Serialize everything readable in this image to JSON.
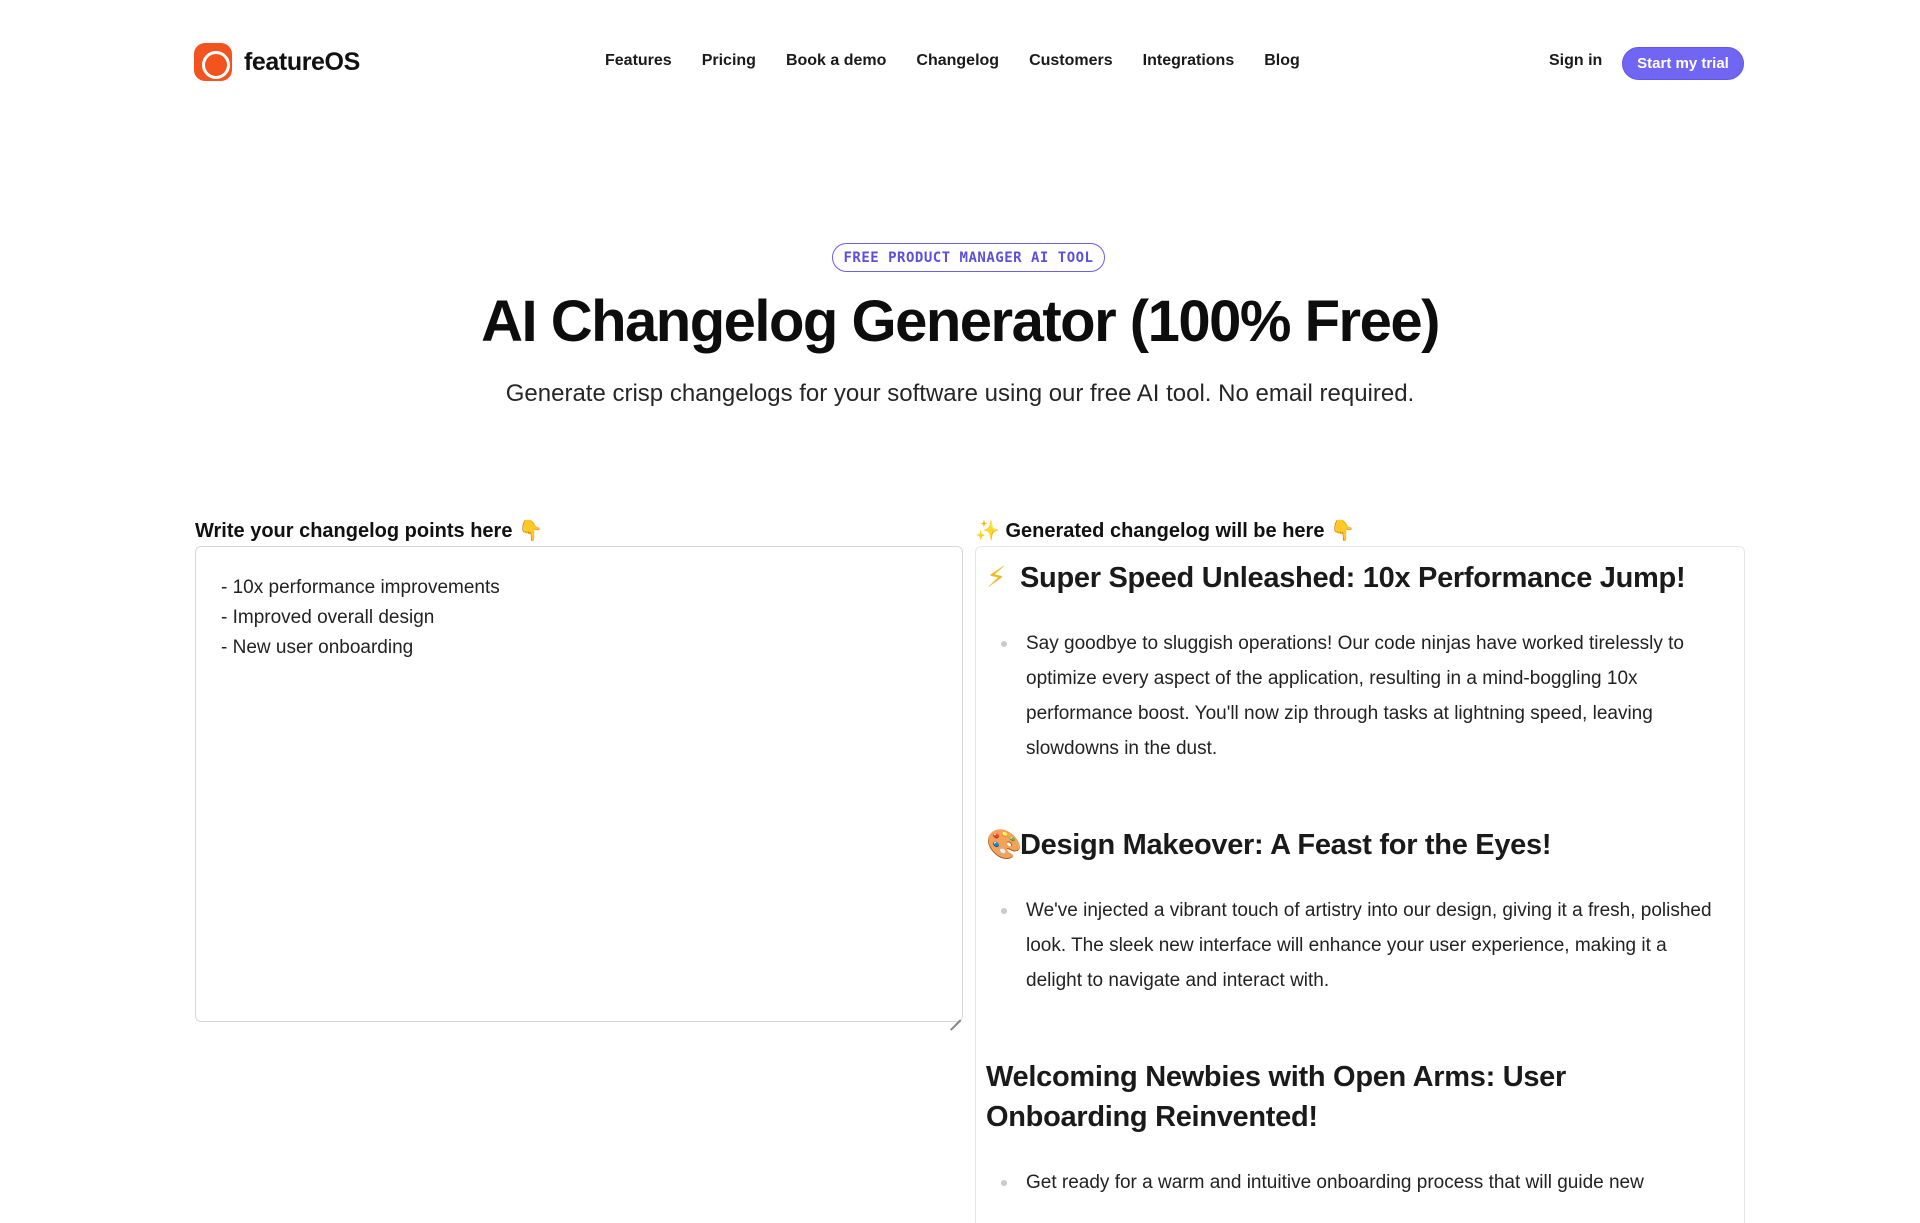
{
  "nav": {
    "brand": "featureOS",
    "links": [
      "Features",
      "Pricing",
      "Book a demo",
      "Changelog",
      "Customers",
      "Integrations",
      "Blog"
    ],
    "sign_in": "Sign in",
    "cta": "Start my trial"
  },
  "hero": {
    "badge": "FREE PRODUCT MANAGER AI TOOL",
    "title": "AI Changelog Generator (100% Free)",
    "subtitle": "Generate crisp changelogs for your software using our free AI tool. No email required."
  },
  "input": {
    "label": "Write your changelog points here",
    "label_emoji": "👇",
    "value": "- 10x performance improvements\n- Improved overall design\n- New user onboarding"
  },
  "output": {
    "label": "Generated changelog will be here",
    "label_prefix_emoji": "✨",
    "label_emoji": "👇",
    "sections": [
      {
        "icon": "⚡",
        "title": "Super Speed Unleashed: 10x Performance Jump!",
        "body": "Say goodbye to sluggish operations! Our code ninjas have worked tirelessly to optimize every aspect of the application, resulting in a mind-boggling 10x performance boost. You'll now zip through tasks at lightning speed, leaving slowdowns in the dust."
      },
      {
        "icon": "🎨",
        "title": "Design Makeover: A Feast for the Eyes!",
        "body": "We've injected a vibrant touch of artistry into our design, giving it a fresh, polished look. The sleek new interface will enhance your user experience, making it a delight to navigate and interact with."
      },
      {
        "icon": "",
        "title": "Welcoming Newbies with Open Arms: User Onboarding Reinvented!",
        "body": "Get ready for a warm and intuitive onboarding process that will guide new"
      }
    ]
  },
  "colors": {
    "brand_orange": "#f2531f",
    "accent_purple": "#7165f4"
  }
}
